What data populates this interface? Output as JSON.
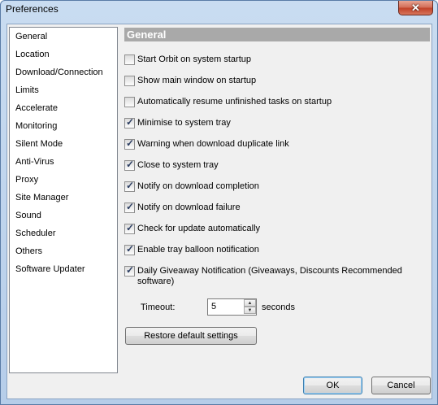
{
  "window": {
    "title": "Preferences",
    "close_glyph": "✕"
  },
  "sidebar": {
    "items": [
      {
        "label": "General"
      },
      {
        "label": "Location"
      },
      {
        "label": "Download/Connection"
      },
      {
        "label": "Limits"
      },
      {
        "label": "Accelerate"
      },
      {
        "label": "Monitoring"
      },
      {
        "label": "Silent Mode"
      },
      {
        "label": "Anti-Virus"
      },
      {
        "label": "Proxy"
      },
      {
        "label": "Site Manager"
      },
      {
        "label": "Sound"
      },
      {
        "label": "Scheduler"
      },
      {
        "label": "Others"
      },
      {
        "label": "Software Updater"
      }
    ],
    "selected": "General"
  },
  "panel": {
    "header": "General",
    "options": [
      {
        "label": "Start Orbit on system startup",
        "checked": false
      },
      {
        "label": "Show main window on startup",
        "checked": false
      },
      {
        "label": "Automatically resume unfinished tasks on startup",
        "checked": false
      },
      {
        "label": "Minimise to system tray",
        "checked": true
      },
      {
        "label": "Warning when download duplicate link",
        "checked": true
      },
      {
        "label": "Close to system tray",
        "checked": true
      },
      {
        "label": "Notify on download completion",
        "checked": true
      },
      {
        "label": "Notify on download failure",
        "checked": true
      },
      {
        "label": "Check for update automatically",
        "checked": true
      },
      {
        "label": "Enable tray balloon notification",
        "checked": true
      },
      {
        "label": "Daily Giveaway Notification (Giveaways, Discounts Recommended software)",
        "checked": true
      }
    ],
    "timeout": {
      "label": "Timeout:",
      "value": "5",
      "unit": "seconds",
      "up_glyph": "▲",
      "down_glyph": "▼"
    },
    "restore_label": "Restore default settings"
  },
  "footer": {
    "ok_label": "OK",
    "cancel_label": "Cancel"
  }
}
